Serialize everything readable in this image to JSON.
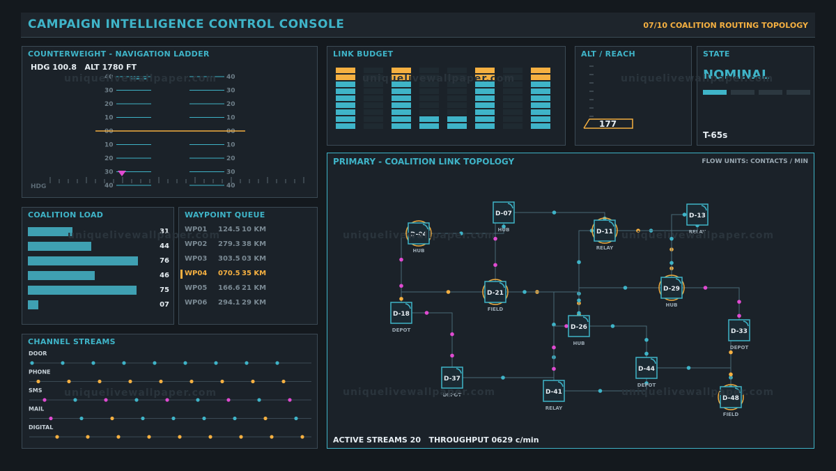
{
  "header": {
    "title": "CAMPAIGN INTELLIGENCE CONTROL CONSOLE",
    "right": "07/10 COALITION ROUTING TOPOLOGY"
  },
  "watermark": "uniquelivewallpaper.com",
  "nav": {
    "title": "COUNTERWEIGHT - NAVIGATION LADDER",
    "readout": "HDG 100.8   ALT 1780 FT",
    "hdg_label": "HDG",
    "ladder_left": [
      "40",
      "30",
      "20",
      "10",
      "00",
      "10",
      "20",
      "30",
      "40"
    ],
    "ladder_right": [
      "40",
      "30",
      "20",
      "10",
      "00",
      "10",
      "20",
      "30",
      "40"
    ]
  },
  "link_budget": {
    "title": "LINK BUDGET",
    "bars": [
      9,
      0,
      9,
      2,
      2,
      9,
      0,
      9
    ],
    "max": 9
  },
  "alt_reach": {
    "title": "ALT / REACH",
    "value": "177"
  },
  "state": {
    "title": "STATE",
    "value": "NOMINAL",
    "timer": "T-65s",
    "segments": [
      1,
      0,
      0,
      0
    ]
  },
  "coalition_load": {
    "title": "COALITION LOAD",
    "rows": [
      {
        "value": 31,
        "label": "31"
      },
      {
        "value": 44,
        "label": "44"
      },
      {
        "value": 76,
        "label": "76"
      },
      {
        "value": 46,
        "label": "46"
      },
      {
        "value": 75,
        "label": "75"
      },
      {
        "value": 7,
        "label": "07"
      }
    ],
    "max": 76
  },
  "waypoints": {
    "title": "WAYPOINT QUEUE",
    "rows": [
      {
        "id": "WP01",
        "bearing": "124.5",
        "dist": "10 KM",
        "active": false
      },
      {
        "id": "WP02",
        "bearing": "279.3",
        "dist": "38 KM",
        "active": false
      },
      {
        "id": "WP03",
        "bearing": "303.5",
        "dist": "03 KM",
        "active": false
      },
      {
        "id": "WP04",
        "bearing": "070.5",
        "dist": "35 KM",
        "active": true
      },
      {
        "id": "WP05",
        "bearing": "166.6",
        "dist": "21 KM",
        "active": false
      },
      {
        "id": "WP06",
        "bearing": "294.1",
        "dist": "29 KM",
        "active": false
      }
    ]
  },
  "channels": {
    "title": "CHANNEL STREAMS",
    "rows": [
      {
        "label": "DOOR",
        "dots": [
          "c",
          "c",
          "c",
          "c",
          "c",
          "c",
          "c",
          "c",
          "c"
        ]
      },
      {
        "label": "PHONE",
        "dots": [
          "y",
          "y",
          "y",
          "y",
          "y",
          "y",
          "y",
          "y",
          "y"
        ]
      },
      {
        "label": "SMS",
        "dots": [
          "m",
          "c",
          "m",
          "c",
          "m",
          "c",
          "m",
          "c",
          "m"
        ]
      },
      {
        "label": "MAIL",
        "dots": [
          "m",
          "c",
          "y",
          "c",
          "c",
          "c",
          "c",
          "y",
          "c"
        ]
      },
      {
        "label": "DIGITAL",
        "dots": [
          "y",
          "y",
          "y",
          "y",
          "y",
          "y",
          "y",
          "y",
          "y"
        ]
      }
    ]
  },
  "topology": {
    "title": "PRIMARY - COALITION LINK TOPOLOGY",
    "units": "FLOW UNITS: CONTACTS / MIN",
    "footer": "ACTIVE STREAMS 20   THROUGHPUT 0629 c/min",
    "nodes": [
      {
        "id": "D-04",
        "type": "HUB",
        "highlight": true
      },
      {
        "id": "D-07",
        "type": "HUB",
        "highlight": false
      },
      {
        "id": "D-11",
        "type": "RELAY",
        "highlight": true
      },
      {
        "id": "D-13",
        "type": "RELAY",
        "highlight": false
      },
      {
        "id": "D-21",
        "type": "FIELD",
        "highlight": true
      },
      {
        "id": "D-29",
        "type": "HUB",
        "highlight": true
      },
      {
        "id": "D-18",
        "type": "DEPOT",
        "highlight": false
      },
      {
        "id": "D-26",
        "type": "HUB",
        "highlight": false
      },
      {
        "id": "D-33",
        "type": "DEPOT",
        "highlight": false
      },
      {
        "id": "D-37",
        "type": "DEPOT",
        "highlight": false
      },
      {
        "id": "D-44",
        "type": "DEPOT",
        "highlight": false
      },
      {
        "id": "D-41",
        "type": "RELAY",
        "highlight": false
      },
      {
        "id": "D-48",
        "type": "FIELD",
        "highlight": true
      }
    ]
  },
  "colors": {
    "cyan": "#3fb4c8",
    "amber": "#f5b041",
    "magenta": "#e04bd1",
    "line": "#4a6a78"
  }
}
